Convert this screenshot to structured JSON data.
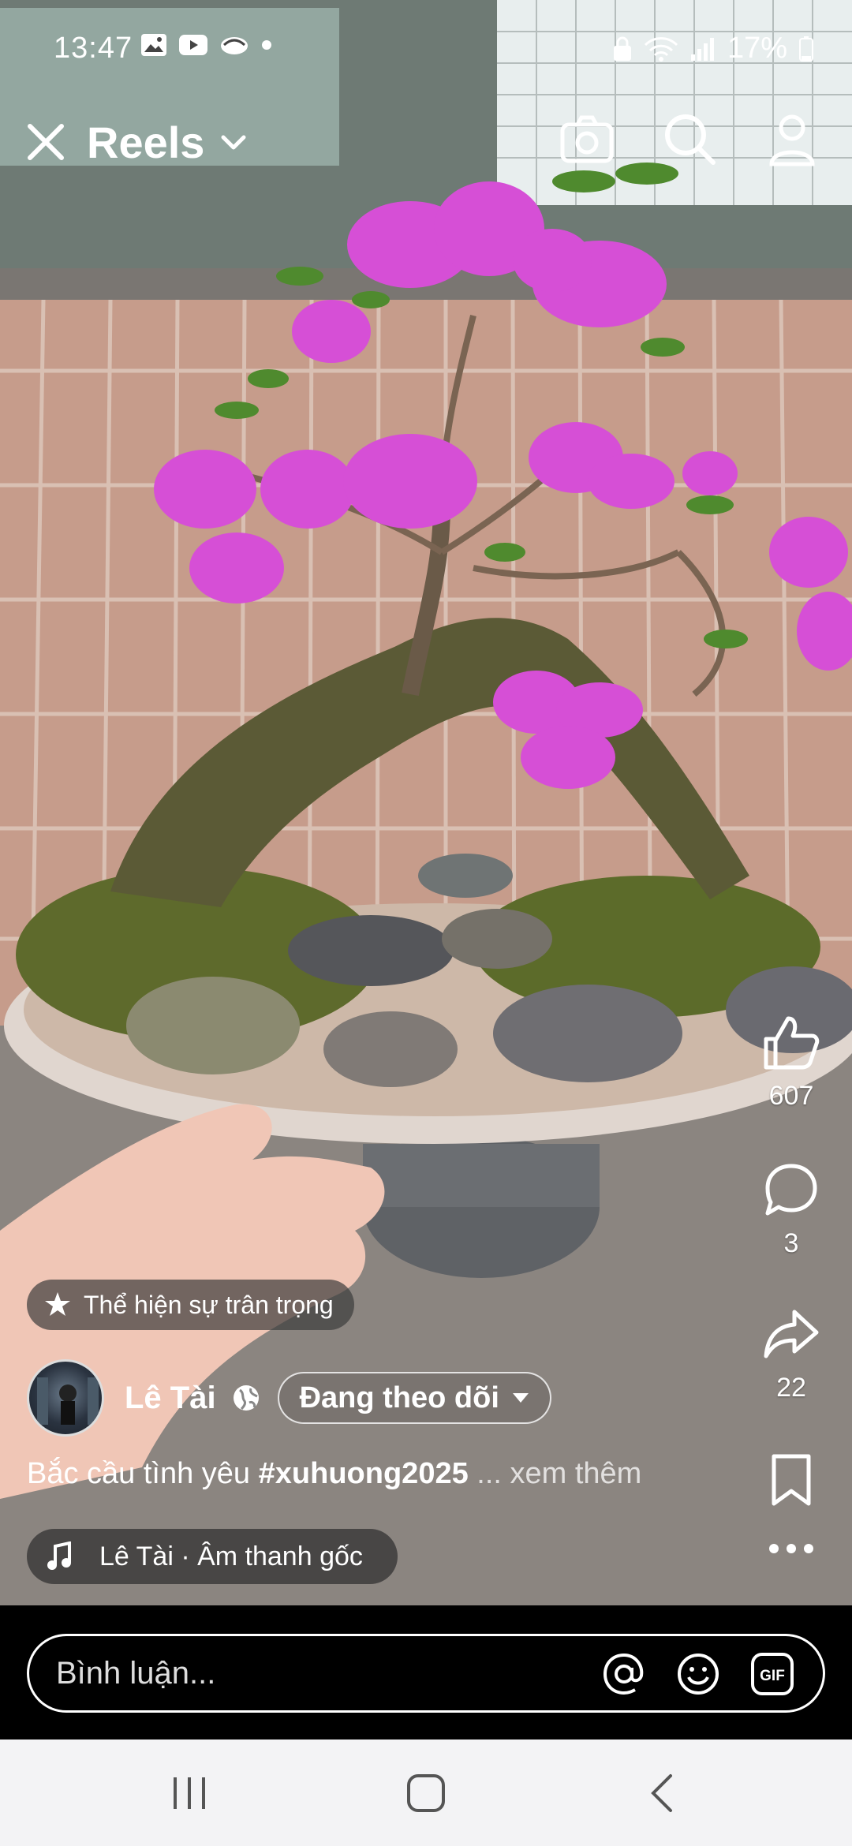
{
  "status_bar": {
    "time": "13:47",
    "battery": "17%",
    "left_icons": [
      "gallery-icon",
      "youtube-icon",
      "cloud-icon",
      "dot-icon"
    ],
    "right_icons": [
      "lock-icon",
      "wifi-icon",
      "signal-icon",
      "battery-icon"
    ]
  },
  "header": {
    "title": "Reels",
    "icons": [
      "close-icon",
      "chevron-down-icon",
      "camera-icon",
      "search-icon",
      "profile-icon"
    ]
  },
  "actions": {
    "like_count": "607",
    "comment_count": "3",
    "share_count": "22"
  },
  "appreciation_label": "Thể hiện sự trân trọng",
  "author": {
    "name": "Lê Tài",
    "follow_label": "Đang theo dõi"
  },
  "caption": {
    "text": "Bắc cầu tình yêu ",
    "hashtag": "#xuhuong2025",
    "more": " ... xem thêm"
  },
  "audio": {
    "label": "Lê Tài · Âm thanh gốc"
  },
  "comment": {
    "placeholder": "Bình luận..."
  },
  "colors": {
    "accent": "#ffffff",
    "flower": "#d64fd6",
    "nav_bar": "#f3f3f5"
  }
}
